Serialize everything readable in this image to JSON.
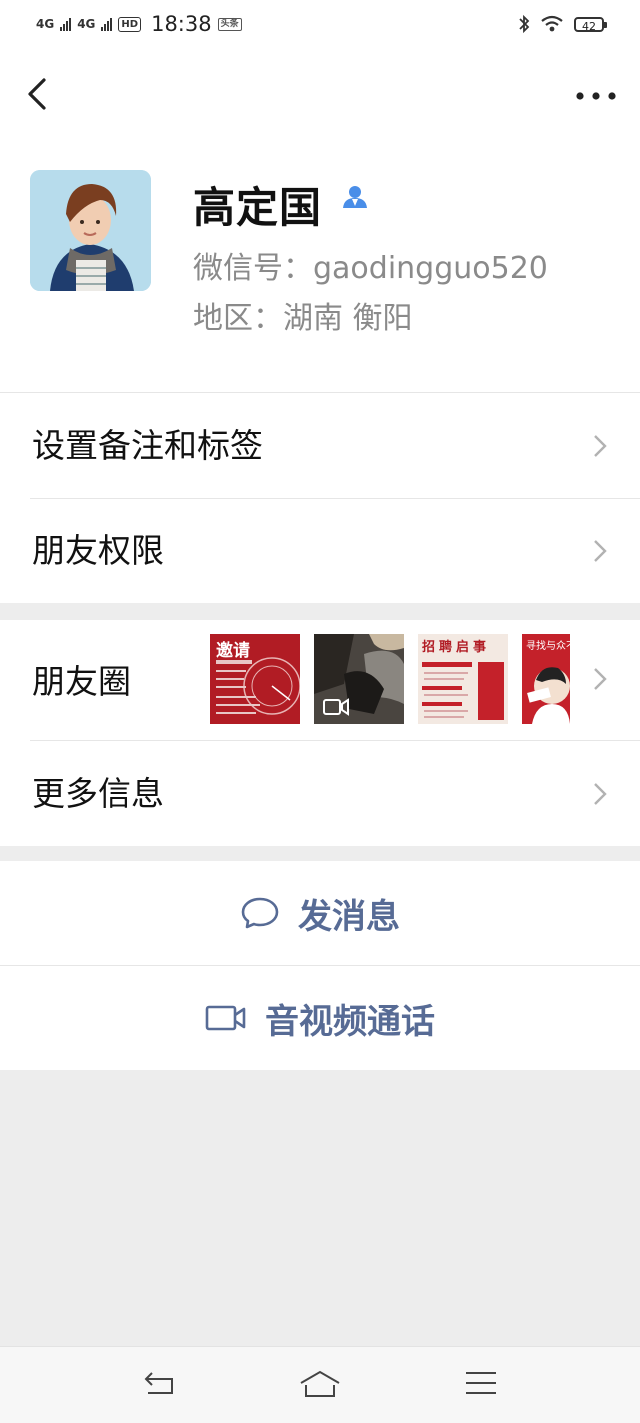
{
  "status_bar": {
    "net1": "4G",
    "net2": "4G",
    "hd": "HD",
    "time": "18:38",
    "app_badge": "头条",
    "battery": "42"
  },
  "profile": {
    "name": "高定国",
    "wechat_id": "微信号：gaodingguo520",
    "region": "地区：湖南  衡阳"
  },
  "menu": {
    "remark_tags": "设置备注和标签",
    "friend_permissions": "朋友权限",
    "moments": "朋友圈",
    "more_info": "更多信息"
  },
  "moments_thumbs": [
    {
      "text": "邀请"
    },
    {
      "text": ""
    },
    {
      "text": "招聘启事"
    },
    {
      "text": "寻找与众不"
    }
  ],
  "actions": {
    "send_message": "发消息",
    "video_call": "音视频通话"
  },
  "icons": {
    "back": "chevron-left-icon",
    "more": "more-dots-icon",
    "contact": "contact-person-icon",
    "chat": "chat-bubble-icon",
    "video": "video-camera-icon",
    "nav_back": "nav-back-icon",
    "nav_home": "nav-home-icon",
    "nav_menu": "nav-menu-icon"
  },
  "colors": {
    "link_blue": "#576b95",
    "badge_blue": "#4a8ee8",
    "background": "#ededed"
  }
}
